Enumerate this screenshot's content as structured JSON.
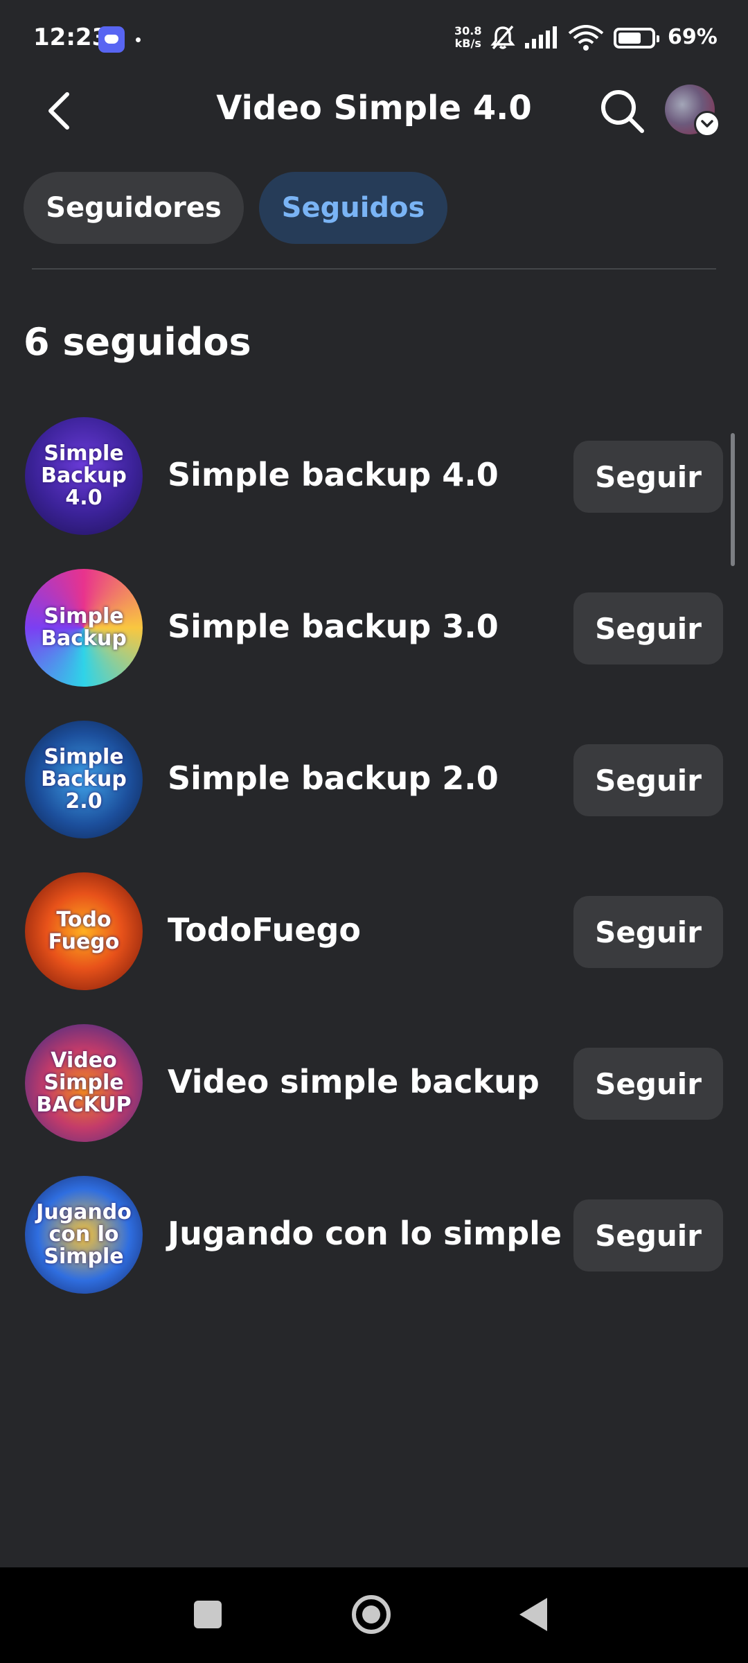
{
  "status_bar": {
    "time": "12:23",
    "net_speed_value": "30.8",
    "net_speed_unit": "kB/s",
    "battery_percent": "69%"
  },
  "header": {
    "title": "Video Simple 4.0"
  },
  "tabs": [
    {
      "label": "Seguidores",
      "selected": false
    },
    {
      "label": "Seguidos",
      "selected": true
    }
  ],
  "count_label": "6 seguidos",
  "following": [
    {
      "name": "Simple backup 4.0",
      "avatar_text": "Simple Backup 4.0",
      "button": "Seguir"
    },
    {
      "name": "Simple backup 3.0",
      "avatar_text": "Simple Backup",
      "button": "Seguir"
    },
    {
      "name": "Simple backup 2.0",
      "avatar_text": "Simple Backup 2.0",
      "button": "Seguir"
    },
    {
      "name": "TodoFuego",
      "avatar_text": "Todo Fuego",
      "button": "Seguir"
    },
    {
      "name": "Video simple backup",
      "avatar_text": "Video Simple BACKUP",
      "button": "Seguir"
    },
    {
      "name": "Jugando con lo simple",
      "avatar_text": "Jugando con lo Simple",
      "button": "Seguir"
    }
  ],
  "colors": {
    "background": "#26272a",
    "tab_selected_bg": "#263c58",
    "tab_selected_text": "#7ab4f5",
    "button_bg": "#3a3b3e"
  }
}
